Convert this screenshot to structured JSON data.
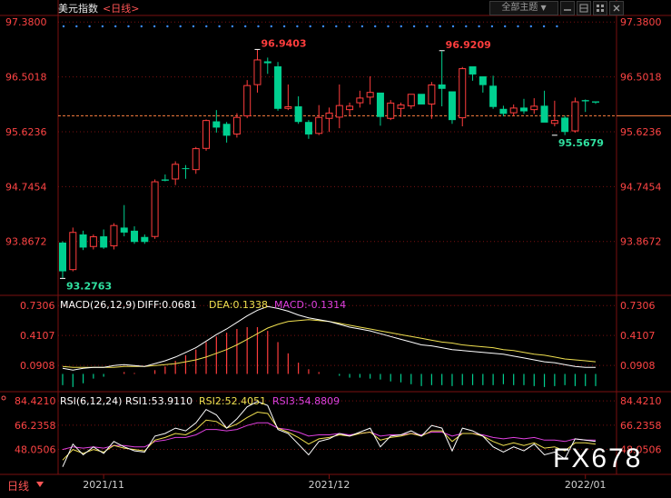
{
  "header": {
    "title": "美元指数",
    "period": "<日线>",
    "theme_button": "全部主题",
    "theme_arrow": "▼"
  },
  "colors": {
    "up": "#ff3d3d",
    "down": "#00d090",
    "grid": "#7a1010",
    "axis_label": "#ff4444",
    "price_line": "#ff8040",
    "diff": "#ffffff",
    "dea": "#f0e050",
    "rsi1": "#ffffff",
    "rsi2": "#f0e050",
    "rsi3": "#e040e0",
    "marker": "#3c8cff",
    "annotation_high": "#ff3d3d",
    "annotation_low": "#30e0a0",
    "watermark": "#ffffff"
  },
  "chart_data": [
    {
      "type": "candlestick",
      "name": "price",
      "y_ticks": [
        "97.3800",
        "96.5018",
        "95.6236",
        "94.7454",
        "93.8672"
      ],
      "y_range": [
        93.02,
        97.47
      ],
      "current_price": 95.88,
      "annotations": [
        {
          "label": "96.9403",
          "index": 19,
          "value": 96.9403,
          "kind": "high"
        },
        {
          "label": "96.9209",
          "index": 37,
          "value": 96.9209,
          "kind": "high"
        },
        {
          "label": "93.2763",
          "index": 0,
          "value": 93.2763,
          "kind": "low"
        },
        {
          "label": "95.5679",
          "index": 48,
          "value": 95.5679,
          "kind": "low"
        }
      ],
      "candles": [
        {
          "o": 93.85,
          "h": 93.87,
          "l": 93.28,
          "c": 93.39
        },
        {
          "o": 93.41,
          "h": 94.09,
          "l": 93.39,
          "c": 94.02
        },
        {
          "o": 93.98,
          "h": 94.04,
          "l": 93.73,
          "c": 93.77
        },
        {
          "o": 93.78,
          "h": 93.98,
          "l": 93.74,
          "c": 93.95
        },
        {
          "o": 93.95,
          "h": 94.06,
          "l": 93.75,
          "c": 93.77
        },
        {
          "o": 93.79,
          "h": 94.16,
          "l": 93.74,
          "c": 94.13
        },
        {
          "o": 94.09,
          "h": 94.45,
          "l": 93.95,
          "c": 94.01
        },
        {
          "o": 94.04,
          "h": 94.11,
          "l": 93.83,
          "c": 93.86
        },
        {
          "o": 93.94,
          "h": 93.98,
          "l": 93.83,
          "c": 93.86
        },
        {
          "o": 93.94,
          "h": 94.86,
          "l": 93.91,
          "c": 94.83
        },
        {
          "o": 94.86,
          "h": 94.94,
          "l": 94.83,
          "c": 94.84
        },
        {
          "o": 94.86,
          "h": 95.15,
          "l": 94.77,
          "c": 95.11
        },
        {
          "o": 95.04,
          "h": 95.09,
          "l": 94.87,
          "c": 95.03
        },
        {
          "o": 95.01,
          "h": 95.38,
          "l": 94.95,
          "c": 95.36
        },
        {
          "o": 95.35,
          "h": 95.82,
          "l": 95.32,
          "c": 95.81
        },
        {
          "o": 95.79,
          "h": 95.97,
          "l": 95.61,
          "c": 95.69
        },
        {
          "o": 95.75,
          "h": 95.78,
          "l": 95.45,
          "c": 95.56
        },
        {
          "o": 95.58,
          "h": 95.92,
          "l": 95.53,
          "c": 95.86
        },
        {
          "o": 95.87,
          "h": 96.45,
          "l": 95.84,
          "c": 96.37
        },
        {
          "o": 96.37,
          "h": 96.94,
          "l": 96.25,
          "c": 96.78
        },
        {
          "o": 96.75,
          "h": 96.81,
          "l": 96.55,
          "c": 96.72
        },
        {
          "o": 96.67,
          "h": 96.74,
          "l": 95.96,
          "c": 95.99
        },
        {
          "o": 95.99,
          "h": 96.38,
          "l": 95.97,
          "c": 96.03
        },
        {
          "o": 96.03,
          "h": 96.19,
          "l": 95.75,
          "c": 95.78
        },
        {
          "o": 95.78,
          "h": 95.81,
          "l": 95.51,
          "c": 95.58
        },
        {
          "o": 95.59,
          "h": 96.05,
          "l": 95.57,
          "c": 95.86
        },
        {
          "o": 95.83,
          "h": 96.01,
          "l": 95.62,
          "c": 95.93
        },
        {
          "o": 95.85,
          "h": 96.38,
          "l": 95.68,
          "c": 96.05
        },
        {
          "o": 95.97,
          "h": 96.09,
          "l": 95.88,
          "c": 96.04
        },
        {
          "o": 96.08,
          "h": 96.28,
          "l": 96.01,
          "c": 96.17
        },
        {
          "o": 96.17,
          "h": 96.51,
          "l": 96.06,
          "c": 96.26
        },
        {
          "o": 96.25,
          "h": 96.23,
          "l": 95.72,
          "c": 95.86
        },
        {
          "o": 95.83,
          "h": 96.13,
          "l": 95.81,
          "c": 96.09
        },
        {
          "o": 95.99,
          "h": 96.09,
          "l": 95.86,
          "c": 96.06
        },
        {
          "o": 96.03,
          "h": 96.21,
          "l": 95.99,
          "c": 96.23
        },
        {
          "o": 96.23,
          "h": 96.22,
          "l": 96.07,
          "c": 96.06
        },
        {
          "o": 96.06,
          "h": 96.42,
          "l": 95.83,
          "c": 96.38
        },
        {
          "o": 96.38,
          "h": 96.91,
          "l": 96.03,
          "c": 96.31
        },
        {
          "o": 96.27,
          "h": 96.27,
          "l": 95.75,
          "c": 95.81
        },
        {
          "o": 95.84,
          "h": 96.66,
          "l": 95.71,
          "c": 96.64
        },
        {
          "o": 96.67,
          "h": 96.63,
          "l": 96.44,
          "c": 96.54
        },
        {
          "o": 96.51,
          "h": 96.48,
          "l": 96.25,
          "c": 96.37
        },
        {
          "o": 96.36,
          "h": 96.52,
          "l": 95.99,
          "c": 96.02
        },
        {
          "o": 95.99,
          "h": 96.04,
          "l": 95.87,
          "c": 95.91
        },
        {
          "o": 95.92,
          "h": 96.06,
          "l": 95.87,
          "c": 96.01
        },
        {
          "o": 96.01,
          "h": 96.15,
          "l": 95.91,
          "c": 95.95
        },
        {
          "o": 95.97,
          "h": 96.16,
          "l": 95.91,
          "c": 96.04
        },
        {
          "o": 96.04,
          "h": 96.28,
          "l": 95.83,
          "c": 95.77
        },
        {
          "o": 95.75,
          "h": 96.12,
          "l": 95.71,
          "c": 95.81
        },
        {
          "o": 95.85,
          "h": 95.88,
          "l": 95.57,
          "c": 95.62
        },
        {
          "o": 95.63,
          "h": 96.17,
          "l": 95.61,
          "c": 96.11
        },
        {
          "o": 96.13,
          "h": 96.14,
          "l": 95.94,
          "c": 96.11
        },
        {
          "o": 96.11,
          "h": 96.09,
          "l": 96.07,
          "c": 96.09
        }
      ]
    },
    {
      "type": "line",
      "name": "macd",
      "params": "MACD(26,12,9)",
      "legend": [
        {
          "key": "diff",
          "text": "DIFF:0.0681"
        },
        {
          "key": "dea",
          "text": "DEA:0.1338"
        },
        {
          "key": "macd",
          "text": "MACD:-0.1314"
        }
      ],
      "y_ticks": [
        "0.7306",
        "0.4107",
        "0.0908"
      ],
      "y_range": [
        -0.18,
        0.82
      ],
      "diff": [
        0.06,
        0.04,
        0.06,
        0.07,
        0.07,
        0.09,
        0.1,
        0.09,
        0.08,
        0.11,
        0.14,
        0.18,
        0.23,
        0.28,
        0.35,
        0.42,
        0.48,
        0.55,
        0.62,
        0.68,
        0.72,
        0.7,
        0.67,
        0.63,
        0.6,
        0.58,
        0.56,
        0.53,
        0.5,
        0.48,
        0.46,
        0.43,
        0.4,
        0.37,
        0.34,
        0.31,
        0.3,
        0.28,
        0.26,
        0.25,
        0.24,
        0.23,
        0.22,
        0.21,
        0.19,
        0.17,
        0.15,
        0.13,
        0.12,
        0.1,
        0.08,
        0.07,
        0.07
      ],
      "dea": [
        0.08,
        0.07,
        0.07,
        0.07,
        0.07,
        0.07,
        0.08,
        0.08,
        0.08,
        0.09,
        0.1,
        0.11,
        0.13,
        0.15,
        0.18,
        0.22,
        0.26,
        0.31,
        0.37,
        0.43,
        0.49,
        0.53,
        0.56,
        0.57,
        0.58,
        0.57,
        0.56,
        0.54,
        0.52,
        0.5,
        0.48,
        0.46,
        0.44,
        0.42,
        0.4,
        0.38,
        0.36,
        0.34,
        0.33,
        0.31,
        0.3,
        0.29,
        0.28,
        0.26,
        0.25,
        0.23,
        0.21,
        0.2,
        0.18,
        0.16,
        0.15,
        0.14,
        0.13
      ],
      "macd": [
        -0.12,
        -0.14,
        -0.1,
        -0.05,
        -0.03,
        0.0,
        0.02,
        0.01,
        0.0,
        0.04,
        0.08,
        0.14,
        0.2,
        0.26,
        0.34,
        0.4,
        0.44,
        0.48,
        0.5,
        0.5,
        0.46,
        0.34,
        0.22,
        0.12,
        0.05,
        0.02,
        0.0,
        -0.02,
        -0.04,
        -0.04,
        -0.05,
        -0.06,
        -0.08,
        -0.09,
        -0.11,
        -0.13,
        -0.12,
        -0.12,
        -0.13,
        -0.12,
        -0.12,
        -0.12,
        -0.12,
        -0.11,
        -0.12,
        -0.12,
        -0.13,
        -0.14,
        -0.13,
        -0.12,
        -0.13,
        -0.13,
        -0.13
      ]
    },
    {
      "type": "line",
      "name": "rsi",
      "params": "RSI(6,12,24)",
      "legend": [
        {
          "key": "rsi1",
          "text": "RSI1:53.9110"
        },
        {
          "key": "rsi2",
          "text": "RSI2:52.4051"
        },
        {
          "key": "rsi3",
          "text": "RSI3:54.8809"
        }
      ],
      "y_ticks": [
        "84.4210",
        "66.2358",
        "48.0506"
      ],
      "y_range": [
        30,
        90
      ],
      "x_ticks": [
        {
          "label": "2021/11",
          "index": 4
        },
        {
          "label": "2021/12",
          "index": 26
        },
        {
          "label": "2022/01",
          "index": 51
        }
      ],
      "rsi1": [
        35,
        52,
        44,
        50,
        45,
        54,
        50,
        47,
        46,
        58,
        60,
        64,
        62,
        68,
        78,
        74,
        64,
        71,
        80,
        84,
        81,
        63,
        60,
        52,
        44,
        54,
        56,
        60,
        58,
        61,
        64,
        50,
        58,
        59,
        62,
        58,
        66,
        64,
        47,
        64,
        62,
        58,
        50,
        46,
        50,
        47,
        52,
        44,
        46,
        41,
        56,
        55,
        54
      ],
      "rsi2": [
        40,
        48,
        45,
        48,
        46,
        51,
        49,
        48,
        47,
        55,
        57,
        60,
        59,
        63,
        70,
        69,
        64,
        67,
        72,
        76,
        75,
        64,
        61,
        57,
        52,
        56,
        57,
        59,
        58,
        60,
        61,
        55,
        57,
        58,
        60,
        58,
        62,
        62,
        54,
        60,
        60,
        58,
        54,
        51,
        53,
        51,
        53,
        49,
        50,
        47,
        53,
        53,
        52
      ],
      "rsi3": [
        48,
        50,
        49,
        50,
        49,
        51,
        51,
        50,
        50,
        54,
        55,
        57,
        57,
        59,
        63,
        63,
        62,
        63,
        66,
        68,
        68,
        64,
        63,
        61,
        58,
        59,
        59,
        60,
        59,
        60,
        61,
        58,
        59,
        59,
        60,
        59,
        61,
        61,
        58,
        60,
        60,
        59,
        57,
        56,
        57,
        56,
        57,
        55,
        55,
        54,
        56,
        55,
        55
      ]
    }
  ],
  "footer": {
    "period_label": "日线",
    "watermark": "FX678"
  }
}
